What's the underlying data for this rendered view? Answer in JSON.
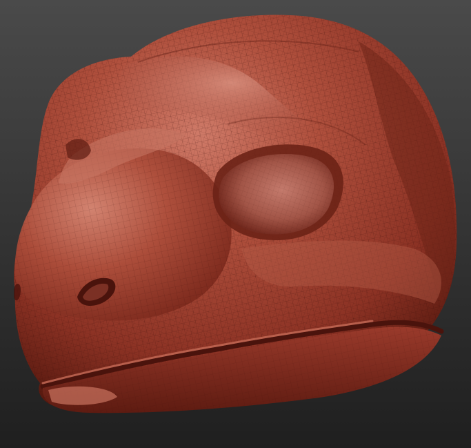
{
  "viewport": {
    "background_top": "#4a4a4a",
    "background_bottom": "#1f1f1f"
  },
  "model": {
    "subject": "sculpted-lizard-head",
    "material_base": "#a2402f",
    "material_highlight": "#d98a78",
    "material_shadow": "#4a130c",
    "wireframe_visible": true
  }
}
